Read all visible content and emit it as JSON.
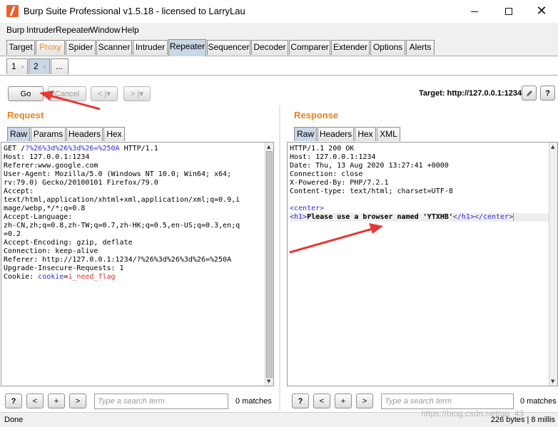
{
  "window": {
    "title": "Burp Suite Professional v1.5.18 - licensed to LarryLau"
  },
  "menu": [
    "Burp",
    "Intruder",
    "Repeater",
    "Window",
    "Help"
  ],
  "main_tabs": [
    "Target",
    "Proxy",
    "Spider",
    "Scanner",
    "Intruder",
    "Repeater",
    "Sequencer",
    "Decoder",
    "Comparer",
    "Extender",
    "Options",
    "Alerts"
  ],
  "active_main_tab": "Repeater",
  "sub_tabs": [
    {
      "label": "1",
      "close": "×"
    },
    {
      "label": "2",
      "close": "×"
    },
    {
      "label": "...",
      "close": ""
    }
  ],
  "toolbar": {
    "go": "Go",
    "cancel": "Cancel",
    "back": "< |▾",
    "forward": "> |▾",
    "target": "Target: http://127.0.0.1:1234",
    "edit_icon": "pencil-icon",
    "help": "?"
  },
  "request": {
    "title": "Request",
    "tabs": [
      "Raw",
      "Params",
      "Headers",
      "Hex"
    ],
    "lines": [
      "GET /?%26%3d%26%3d%26=%250A HTTP/1.1",
      "Host: 127.0.0.1:1234",
      "Referer:www.google.com",
      "User-Agent: Mozilla/5.0 (Windows NT 10.0; Win64; x64;",
      "rv:79.0) Gecko/20100101 Firefox/79.0",
      "Accept:",
      "text/html,application/xhtml+xml,application/xml;q=0.9,i",
      "mage/webp,*/*;q=0.8",
      "Accept-Language:",
      "zh-CN,zh;q=0.8,zh-TW;q=0.7,zh-HK;q=0.5,en-US;q=0.3,en;q",
      "=0.2",
      "Accept-Encoding: gzip, deflate",
      "Connection: keep-alive",
      "Referer: http://127.0.0.1:1234/?%26%3d%26%3d%26=%250A",
      "Upgrade-Insecure-Requests: 1",
      "Cookie: cookie=i_need_flag"
    ]
  },
  "response": {
    "title": "Response",
    "tabs": [
      "Raw",
      "Headers",
      "Hex",
      "XML"
    ],
    "lines": [
      "HTTP/1.1 200 OK",
      "Host: 127.0.0.1:1234",
      "Date: Thu, 13 Aug 2020 13:27:41 +0000",
      "Connection: close",
      "X-Powered-By: PHP/7.2.1",
      "Content-type: text/html; charset=UTF-8",
      "",
      "<center>",
      "<h1>Please use a browser named 'YTXHB'</h1></center>"
    ]
  },
  "search": {
    "placeholder": "Type a search term",
    "request_matches": "0 matches",
    "response_matches": "0 matches",
    "help": "?",
    "prev": "<",
    "add": "+",
    "next": ">"
  },
  "status": {
    "left": "Done",
    "right": "226 bytes | 8 millis"
  },
  "watermark": "https://blog.csdn.net/qq_43_"
}
